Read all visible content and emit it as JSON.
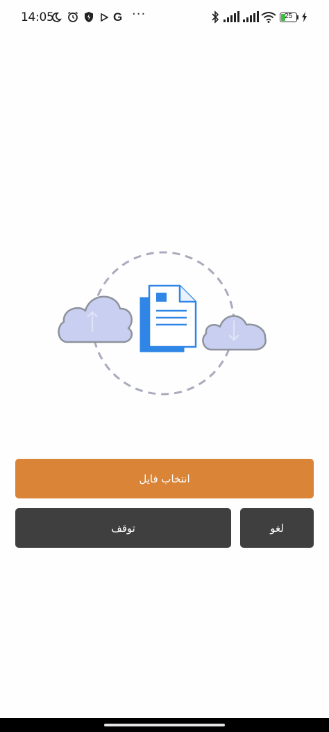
{
  "status_bar": {
    "time": "14:05",
    "battery_level": "25",
    "icons": [
      "moon-icon",
      "alarm-icon",
      "shield-icon",
      "play-icon",
      "google-icon",
      "more-dots-icon",
      "bluetooth-icon",
      "signal-icon",
      "signal-icon",
      "wifi-icon",
      "battery-icon",
      "charging-icon"
    ],
    "google_glyph": "G",
    "more_glyph": "···"
  },
  "illustration": {
    "icons": [
      "upload-cloud-icon",
      "document-icon",
      "download-cloud-icon"
    ],
    "colors": {
      "cloud_fill": "#c9cff0",
      "cloud_stroke": "#8e929c",
      "document_blue": "#2f86e6",
      "dashed_circle": "#a9aabd"
    }
  },
  "actions": {
    "select_file_label": "انتخاب فایل",
    "pause_label": "توقف",
    "cancel_label": "لغو",
    "colors": {
      "primary": "#d98437",
      "secondary": "#3f3f3f"
    }
  }
}
